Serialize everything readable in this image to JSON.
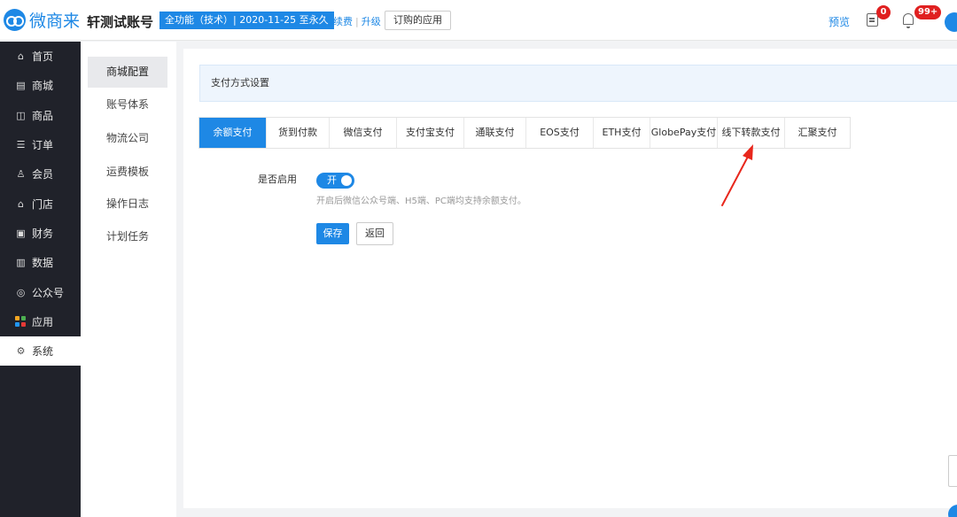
{
  "header": {
    "logo_text": "微商来",
    "account_name": "轩测试账号",
    "plan_badge": "全功能（技术）| 2020-11-25 至永久",
    "renew_label": "续费",
    "separator": "|",
    "upgrade_label": "升级",
    "subscribed_apps_label": "订购的应用",
    "preview_label": "预览",
    "doc_badge_count": "0",
    "notification_badge_count": "99+"
  },
  "sidebar": {
    "items": [
      {
        "label": "首页",
        "icon": "home-icon",
        "glyph": "⌂"
      },
      {
        "label": "商城",
        "icon": "store-icon",
        "glyph": "▤"
      },
      {
        "label": "商品",
        "icon": "goods-icon",
        "glyph": "◫"
      },
      {
        "label": "订单",
        "icon": "order-icon",
        "glyph": "☰"
      },
      {
        "label": "会员",
        "icon": "member-icon",
        "glyph": "♙"
      },
      {
        "label": "门店",
        "icon": "shop-icon",
        "glyph": "⌂"
      },
      {
        "label": "财务",
        "icon": "finance-icon",
        "glyph": "▣"
      },
      {
        "label": "数据",
        "icon": "data-icon",
        "glyph": "▥"
      },
      {
        "label": "公众号",
        "icon": "wechat-official-icon",
        "glyph": "◎"
      },
      {
        "label": "应用",
        "icon": "apps-icon",
        "glyph": ""
      },
      {
        "label": "系统",
        "icon": "settings-icon",
        "glyph": "⚙"
      }
    ],
    "active_index": 10,
    "apps_icon_colors": [
      "#f5a623",
      "#4caf50",
      "#2196f3",
      "#e53935"
    ]
  },
  "subnav": {
    "items": [
      "商城配置",
      "账号体系",
      "物流公司",
      "运费模板",
      "操作日志",
      "计划任务"
    ],
    "active_index": 0
  },
  "main": {
    "section_title": "支付方式设置",
    "tabs": [
      "余额支付",
      "货到付款",
      "微信支付",
      "支付宝支付",
      "通联支付",
      "EOS支付",
      "ETH支付",
      "GlobePay支付",
      "线下转款支付",
      "汇聚支付"
    ],
    "active_tab": 0,
    "enable_label": "是否启用",
    "switch_text": "开",
    "switch_on": true,
    "hint": "开启后微信公众号端、H5端、PC端均支持余额支付。",
    "save_label": "保存",
    "back_label": "返回"
  },
  "colors": {
    "accent": "#1e88e5",
    "sidebar_bg": "#20222a",
    "badge_red": "#e02020",
    "annotation_arrow": "#e8271c"
  }
}
